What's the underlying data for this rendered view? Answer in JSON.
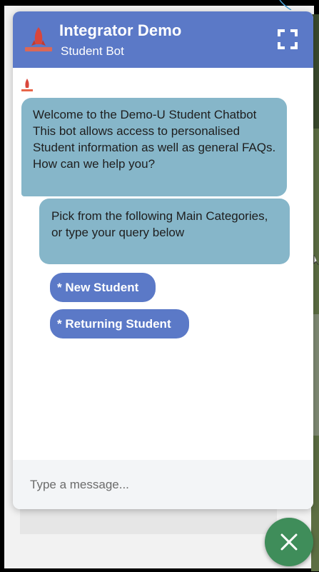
{
  "header": {
    "title": "Integrator Demo",
    "subtitle": "Student Bot",
    "logo_icon": "adapt-it-logo-icon",
    "expand_icon": "expand-icon"
  },
  "messages": [
    {
      "sender": "bot",
      "text": "Welcome to the Demo-U Student Chatbot This bot allows access to personalised Student information as well as general FAQs. How can we help you?"
    },
    {
      "sender": "bot",
      "text": "Pick from the following Main Categories, or type your query below"
    }
  ],
  "options": [
    {
      "label": "* New Student"
    },
    {
      "label": "* Returning Student"
    }
  ],
  "composer": {
    "placeholder": "Type a message...",
    "value": ""
  },
  "close_button": {
    "icon": "close-icon"
  },
  "colors": {
    "header": "#5b79c7",
    "bubble": "#86b6c9",
    "option_button": "#5b79c7",
    "close_button": "#3f8d5a"
  }
}
